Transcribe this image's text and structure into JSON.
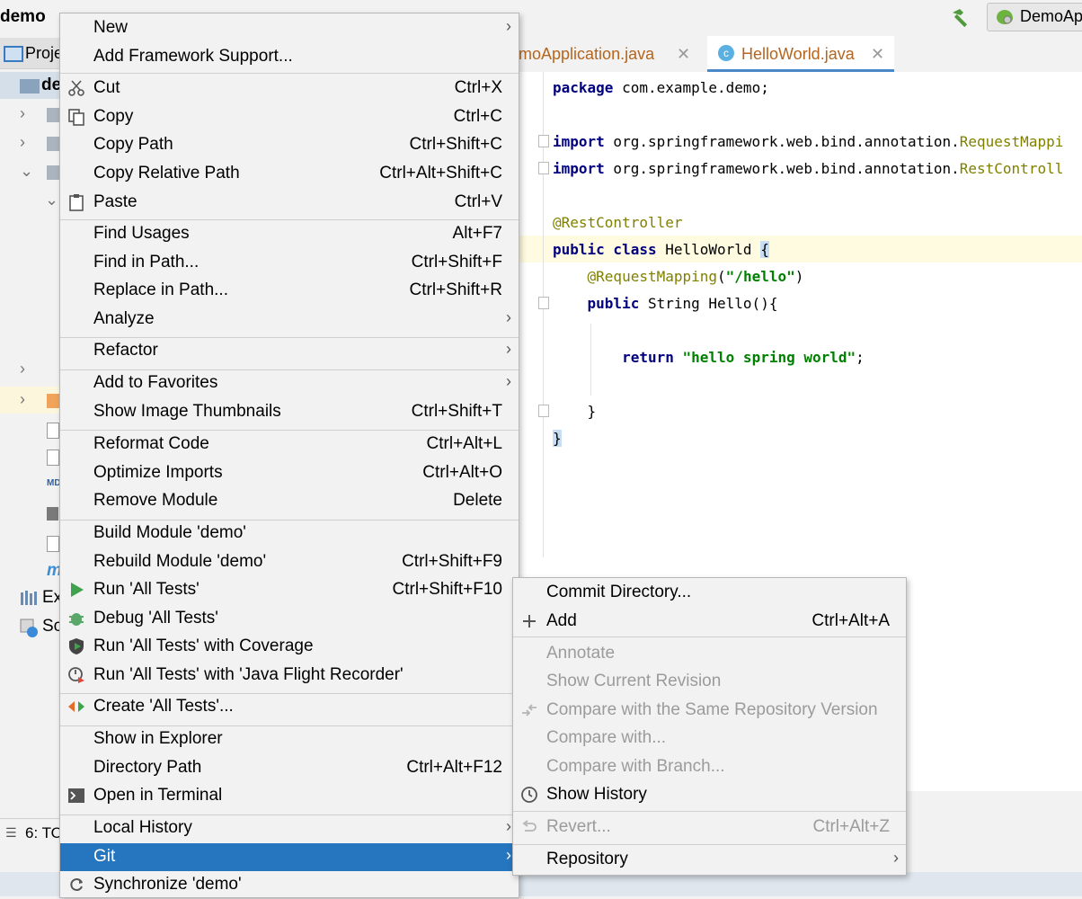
{
  "window": {
    "project_title": "demo",
    "run_config": "DemoAp"
  },
  "left_panel": {
    "project_tab": "Proje",
    "root_item": "de",
    "tree_partial_1": "Ex",
    "tree_partial_2": "Sc",
    "bottom_tab": "6: TO"
  },
  "editor": {
    "tabs": [
      {
        "label": "emoApplication.java"
      },
      {
        "label": "HelloWorld.java"
      }
    ],
    "code_lines": [
      {
        "text": "package com.example.demo;"
      },
      {
        "text": ""
      },
      {
        "text": "import org.springframework.web.bind.annotation.RequestMappi"
      },
      {
        "text": "import org.springframework.web.bind.annotation.RestControll"
      },
      {
        "text": ""
      },
      {
        "text": "@RestController"
      },
      {
        "text": "public class HelloWorld {"
      },
      {
        "text": "    @RequestMapping(\"/hello\")"
      },
      {
        "text": "    public String Hello(){"
      },
      {
        "text": ""
      },
      {
        "text": "        return \"hello spring world\";"
      },
      {
        "text": ""
      },
      {
        "text": "    }"
      },
      {
        "text": "}"
      }
    ]
  },
  "context_menu": {
    "items": [
      {
        "label": "New",
        "shortcut": "",
        "submenu": true
      },
      {
        "label": "Add Framework Support...",
        "shortcut": ""
      },
      {
        "label": "Cut",
        "shortcut": "Ctrl+X",
        "icon": "scissors-icon"
      },
      {
        "label": "Copy",
        "shortcut": "Ctrl+C",
        "icon": "copy-icon"
      },
      {
        "label": "Copy Path",
        "shortcut": "Ctrl+Shift+C"
      },
      {
        "label": "Copy Relative Path",
        "shortcut": "Ctrl+Alt+Shift+C"
      },
      {
        "label": "Paste",
        "shortcut": "Ctrl+V",
        "icon": "clipboard-icon"
      },
      {
        "label": "Find Usages",
        "shortcut": "Alt+F7"
      },
      {
        "label": "Find in Path...",
        "shortcut": "Ctrl+Shift+F"
      },
      {
        "label": "Replace in Path...",
        "shortcut": "Ctrl+Shift+R"
      },
      {
        "label": "Analyze",
        "shortcut": "",
        "submenu": true
      },
      {
        "label": "Refactor",
        "shortcut": "",
        "submenu": true
      },
      {
        "label": "Add to Favorites",
        "shortcut": "",
        "submenu": true
      },
      {
        "label": "Show Image Thumbnails",
        "shortcut": "Ctrl+Shift+T"
      },
      {
        "label": "Reformat Code",
        "shortcut": "Ctrl+Alt+L"
      },
      {
        "label": "Optimize Imports",
        "shortcut": "Ctrl+Alt+O"
      },
      {
        "label": "Remove Module",
        "shortcut": "Delete"
      },
      {
        "label": "Build Module 'demo'",
        "shortcut": ""
      },
      {
        "label": "Rebuild Module 'demo'",
        "shortcut": "Ctrl+Shift+F9"
      },
      {
        "label": "Run 'All Tests'",
        "shortcut": "Ctrl+Shift+F10",
        "icon": "run-icon"
      },
      {
        "label": "Debug 'All Tests'",
        "shortcut": "",
        "icon": "debug-icon"
      },
      {
        "label": "Run 'All Tests' with Coverage",
        "shortcut": "",
        "icon": "coverage-icon"
      },
      {
        "label": "Run 'All Tests' with 'Java Flight Recorder'",
        "shortcut": "",
        "icon": "profiler-icon"
      },
      {
        "label": "Create 'All Tests'...",
        "shortcut": "",
        "icon": "create-test-icon"
      },
      {
        "label": "Show in Explorer",
        "shortcut": ""
      },
      {
        "label": "Directory Path",
        "shortcut": "Ctrl+Alt+F12"
      },
      {
        "label": "Open in Terminal",
        "shortcut": "",
        "icon": "terminal-icon"
      },
      {
        "label": "Local History",
        "shortcut": "",
        "submenu": true
      },
      {
        "label": "Git",
        "shortcut": "",
        "submenu": true,
        "selected": true
      },
      {
        "label": "Synchronize 'demo'",
        "shortcut": "",
        "icon": "sync-icon"
      }
    ]
  },
  "git_submenu": {
    "items": [
      {
        "label": "Commit Directory...",
        "shortcut": ""
      },
      {
        "label": "Add",
        "shortcut": "Ctrl+Alt+A",
        "icon": "plus-icon"
      },
      {
        "label": "Annotate",
        "shortcut": "",
        "disabled": true
      },
      {
        "label": "Show Current Revision",
        "shortcut": "",
        "disabled": true
      },
      {
        "label": "Compare with the Same Repository Version",
        "shortcut": "",
        "disabled": true,
        "icon": "compare-icon"
      },
      {
        "label": "Compare with...",
        "shortcut": "",
        "disabled": true
      },
      {
        "label": "Compare with Branch...",
        "shortcut": "",
        "disabled": true
      },
      {
        "label": "Show History",
        "shortcut": "",
        "icon": "clock-icon"
      },
      {
        "label": "Revert...",
        "shortcut": "Ctrl+Alt+Z",
        "disabled": true,
        "icon": "revert-icon"
      },
      {
        "label": "Repository",
        "shortcut": "",
        "submenu": true
      }
    ]
  }
}
